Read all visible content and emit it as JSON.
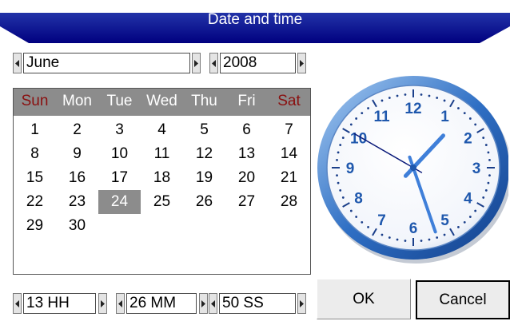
{
  "window": {
    "title": "Date and time",
    "title_color": "#00007f"
  },
  "date": {
    "month": "June",
    "year": "2008"
  },
  "calendar": {
    "weekdays": [
      "Sun",
      "Mon",
      "Tue",
      "Wed",
      "Thu",
      "Fri",
      "Sat"
    ],
    "weeks": [
      [
        "1",
        "2",
        "3",
        "4",
        "5",
        "6",
        "7"
      ],
      [
        "8",
        "9",
        "10",
        "11",
        "12",
        "13",
        "14"
      ],
      [
        "15",
        "16",
        "17",
        "18",
        "19",
        "20",
        "21"
      ],
      [
        "22",
        "23",
        "24",
        "25",
        "26",
        "27",
        "28"
      ],
      [
        "29",
        "30",
        "",
        "",
        "",
        "",
        ""
      ]
    ],
    "selected_day": "24",
    "weekend_color": "#8a1010",
    "header_bg": "#8c8c8c"
  },
  "clock": {
    "numerals": [
      "12",
      "1",
      "2",
      "3",
      "4",
      "5",
      "6",
      "7",
      "8",
      "9",
      "10",
      "11"
    ],
    "hour": 13,
    "minute": 26,
    "second": 50,
    "face_color": "#2f6fc4"
  },
  "time": {
    "hours": "13 HH",
    "minutes": "26 MM",
    "seconds": "50 SS"
  },
  "buttons": {
    "ok": "OK",
    "cancel": "Cancel"
  },
  "icons": {
    "spin_left": "triangle-left-icon",
    "spin_right": "triangle-right-icon"
  }
}
